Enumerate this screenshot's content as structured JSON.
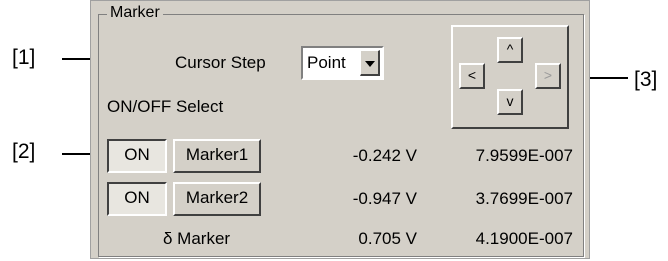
{
  "callouts": {
    "c1": "[1]",
    "c2": "[2]",
    "c3": "[3]"
  },
  "marker_panel": {
    "title": "Marker",
    "cursor_step_label": "Cursor Step",
    "cursor_step_value": "Point",
    "onoff_select_label": "ON/OFF  Select",
    "nav": {
      "up": "^",
      "down": "v",
      "left": "<",
      "right": ">"
    },
    "rows": [
      {
        "toggle": "ON",
        "marker": "Marker1",
        "voltage": "-0.242 V",
        "time": "7.9599E-007"
      },
      {
        "toggle": "ON",
        "marker": "Marker2",
        "voltage": "-0.947 V",
        "time": "3.7699E-007"
      }
    ],
    "delta": {
      "label": "δ Marker",
      "voltage": "0.705 V",
      "time": "4.1900E-007"
    }
  }
}
